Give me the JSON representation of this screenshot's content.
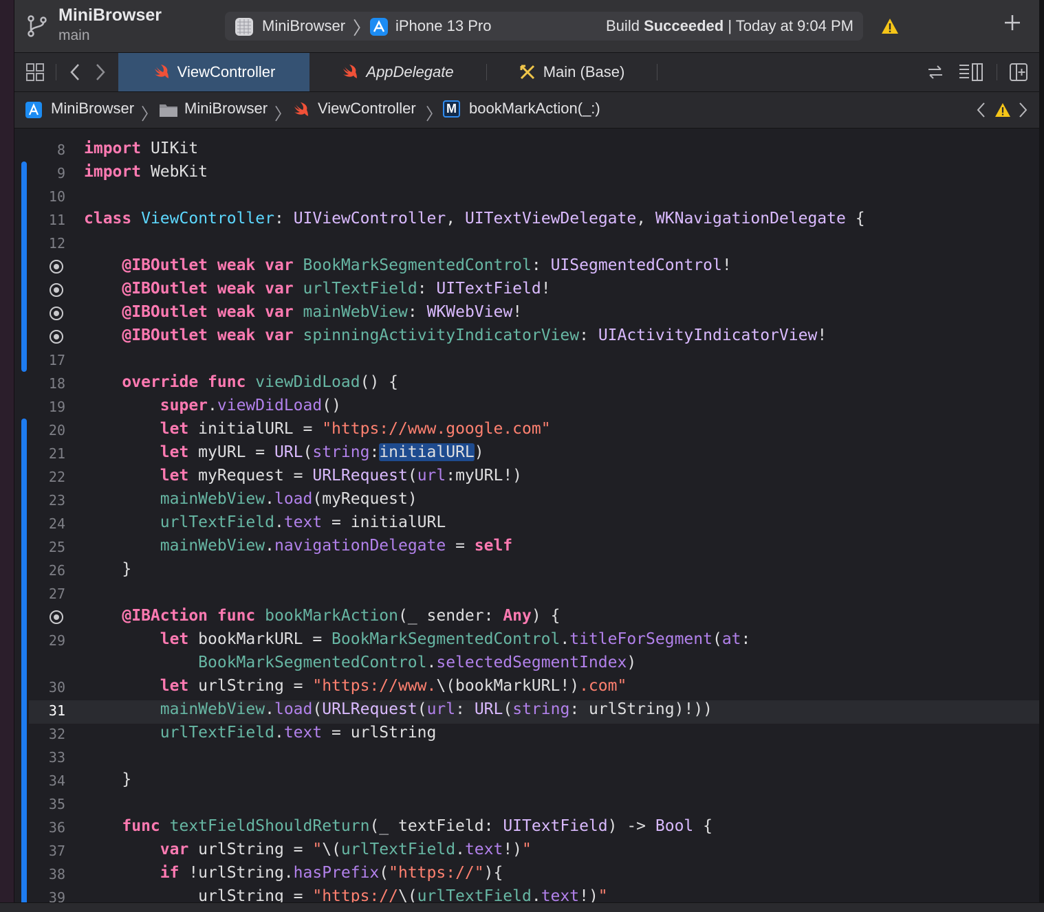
{
  "toolbar": {
    "project_name": "MiniBrowser",
    "branch": "main",
    "scheme_target": "MiniBrowser",
    "device": "iPhone 13 Pro",
    "status_prefix": "Build ",
    "status_bold": "Succeeded",
    "status_suffix": " | Today at 9:04 PM"
  },
  "tabs": [
    {
      "label": "ViewController",
      "icon": "swift-icon",
      "active": true
    },
    {
      "label": "AppDelegate",
      "icon": "swift-icon",
      "active": false
    },
    {
      "label": "Main (Base)",
      "icon": "storyboard-icon",
      "active": false
    }
  ],
  "breadcrumb": {
    "project": "MiniBrowser",
    "folder": "MiniBrowser",
    "file": "ViewController",
    "method_badge": "M",
    "method": "bookMarkAction(_:)"
  },
  "colors": {
    "keyword": "#ff7ab2",
    "type": "#dabaff",
    "declared_type": "#5dd8ff",
    "property": "#67b7a4",
    "function": "#b281eb",
    "string": "#ff8170",
    "active_tab": "#355273",
    "change_bar": "#1e7cf1"
  },
  "editor": {
    "current_line": "31",
    "lines": [
      {
        "n": "8",
        "outlet": false,
        "code": "<span class='kw'>import</span> UIKit"
      },
      {
        "n": "9",
        "outlet": false,
        "code": "<span class='kw'>import</span> WebKit"
      },
      {
        "n": "10",
        "outlet": false,
        "code": ""
      },
      {
        "n": "11",
        "outlet": false,
        "code": "<span class='kw'>class</span> <span class='tyd'>ViewController</span>: <span class='ty'>UIViewController</span>, <span class='ty'>UITextViewDelegate</span>, <span class='ty'>WKNavigationDelegate</span> {"
      },
      {
        "n": "12",
        "outlet": false,
        "code": ""
      },
      {
        "n": "",
        "outlet": true,
        "code": "    <span class='kw'>@IBOutlet</span> <span class='kw'>weak</span> <span class='kw'>var</span> <span class='pr'>BookMarkSegmentedControl</span>: <span class='ty'>UISegmentedControl</span>!"
      },
      {
        "n": "",
        "outlet": true,
        "code": "    <span class='kw'>@IBOutlet</span> <span class='kw'>weak</span> <span class='kw'>var</span> <span class='pr'>urlTextField</span>: <span class='ty'>UITextField</span>!"
      },
      {
        "n": "",
        "outlet": true,
        "code": "    <span class='kw'>@IBOutlet</span> <span class='kw'>weak</span> <span class='kw'>var</span> <span class='pr'>mainWebView</span>: <span class='ty'>WKWebView</span>!"
      },
      {
        "n": "",
        "outlet": true,
        "code": "    <span class='kw'>@IBOutlet</span> <span class='kw'>weak</span> <span class='kw'>var</span> <span class='pr'>spinningActivityIndicatorView</span>: <span class='ty'>UIActivityIndicatorView</span>!"
      },
      {
        "n": "17",
        "outlet": false,
        "code": ""
      },
      {
        "n": "18",
        "outlet": false,
        "code": "    <span class='kw'>override</span> <span class='kw'>func</span> <span class='pr'>viewDidLoad</span>() {"
      },
      {
        "n": "19",
        "outlet": false,
        "code": "        <span class='kw'>super</span>.<span class='fn'>viewDidLoad</span>()"
      },
      {
        "n": "20",
        "outlet": false,
        "code": "        <span class='kw'>let</span> initialURL = <span class='st'>\"https://www.google.com\"</span>"
      },
      {
        "n": "21",
        "outlet": false,
        "code": "        <span class='kw'>let</span> myURL = <span class='ty'>URL</span>(<span class='fn'>string</span>:<span class='sel'>initialURL</span>)"
      },
      {
        "n": "22",
        "outlet": false,
        "code": "        <span class='kw'>let</span> myRequest = <span class='ty'>URLRequest</span>(<span class='fn'>url</span>:myURL!)"
      },
      {
        "n": "23",
        "outlet": false,
        "code": "        <span class='pr'>mainWebView</span>.<span class='fn'>load</span>(myRequest)"
      },
      {
        "n": "24",
        "outlet": false,
        "code": "        <span class='pr'>urlTextField</span>.<span class='fn'>text</span> = initialURL"
      },
      {
        "n": "25",
        "outlet": false,
        "code": "        <span class='pr'>mainWebView</span>.<span class='fn'>navigationDelegate</span> = <span class='kw'>self</span>"
      },
      {
        "n": "26",
        "outlet": false,
        "code": "    }"
      },
      {
        "n": "27",
        "outlet": false,
        "code": ""
      },
      {
        "n": "",
        "outlet": true,
        "code": "    <span class='kw'>@IBAction</span> <span class='kw'>func</span> <span class='pr'>bookMarkAction</span>(_ sender: <span class='kw'>Any</span>) {"
      },
      {
        "n": "29",
        "outlet": false,
        "code": "        <span class='kw'>let</span> bookMarkURL = <span class='pr'>BookMarkSegmentedControl</span>.<span class='fn'>titleForSegment</span>(<span class='fn'>at</span>:"
      },
      {
        "n": "",
        "outlet": false,
        "code": "            <span class='pr'>BookMarkSegmentedControl</span>.<span class='fn'>selectedSegmentIndex</span>)"
      },
      {
        "n": "30",
        "outlet": false,
        "code": "        <span class='kw'>let</span> urlString = <span class='st'>\"https://www.</span>\\(bookMarkURL!)<span class='st'>.com\"</span>"
      },
      {
        "n": "31",
        "outlet": false,
        "code": "        <span class='pr'>mainWebView</span>.<span class='fn'>load</span>(<span class='ty'>URLRequest</span>(<span class='fn'>url</span>: <span class='ty'>URL</span>(<span class='fn'>string</span>: urlString)!))"
      },
      {
        "n": "32",
        "outlet": false,
        "code": "        <span class='pr'>urlTextField</span>.<span class='fn'>text</span> = urlString"
      },
      {
        "n": "33",
        "outlet": false,
        "code": ""
      },
      {
        "n": "34",
        "outlet": false,
        "code": "    }"
      },
      {
        "n": "35",
        "outlet": false,
        "code": ""
      },
      {
        "n": "36",
        "outlet": false,
        "code": "    <span class='kw'>func</span> <span class='pr'>textFieldShouldReturn</span>(_ textField: <span class='ty'>UITextField</span>) -&gt; <span class='ty'>Bool</span> {"
      },
      {
        "n": "37",
        "outlet": false,
        "code": "        <span class='kw'>var</span> urlString = <span class='st'>\"</span>\\(<span class='pr'>urlTextField</span>.<span class='fn'>text</span>!)<span class='st'>\"</span>"
      },
      {
        "n": "38",
        "outlet": false,
        "code": "        <span class='kw'>if</span> !urlString.<span class='fn'>hasPrefix</span>(<span class='st'>\"https://\"</span>){"
      },
      {
        "n": "39",
        "outlet": false,
        "code": "            urlString = <span class='st'>\"https://</span>\\(<span class='pr'>urlTextField</span>.<span class='fn'>text</span>!)<span class='st'>\"</span>"
      }
    ]
  }
}
